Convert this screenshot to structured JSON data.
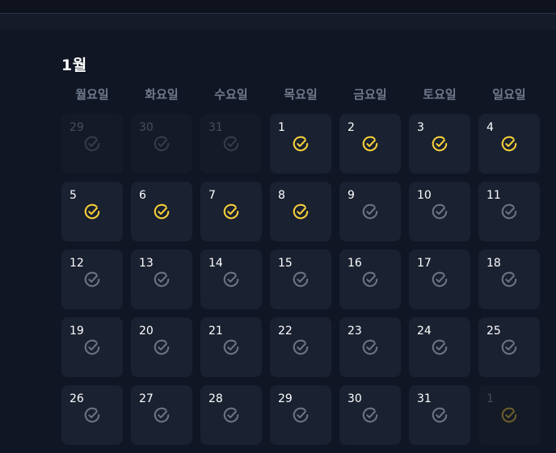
{
  "calendar": {
    "month_label": "1월",
    "weekdays": [
      "월요일",
      "화요일",
      "수요일",
      "목요일",
      "금요일",
      "토요일",
      "일요일"
    ],
    "colors": {
      "checked": "#f5cf3a",
      "unchecked": "#6b7484",
      "dim_unchecked": "#353c49",
      "dim_checked": "#6b5e2a"
    },
    "days": [
      {
        "label": "29",
        "in_month": false,
        "checked": false
      },
      {
        "label": "30",
        "in_month": false,
        "checked": false
      },
      {
        "label": "31",
        "in_month": false,
        "checked": false
      },
      {
        "label": "1",
        "in_month": true,
        "checked": true
      },
      {
        "label": "2",
        "in_month": true,
        "checked": true
      },
      {
        "label": "3",
        "in_month": true,
        "checked": true
      },
      {
        "label": "4",
        "in_month": true,
        "checked": true
      },
      {
        "label": "5",
        "in_month": true,
        "checked": true
      },
      {
        "label": "6",
        "in_month": true,
        "checked": true
      },
      {
        "label": "7",
        "in_month": true,
        "checked": true
      },
      {
        "label": "8",
        "in_month": true,
        "checked": true
      },
      {
        "label": "9",
        "in_month": true,
        "checked": false
      },
      {
        "label": "10",
        "in_month": true,
        "checked": false
      },
      {
        "label": "11",
        "in_month": true,
        "checked": false
      },
      {
        "label": "12",
        "in_month": true,
        "checked": false
      },
      {
        "label": "13",
        "in_month": true,
        "checked": false
      },
      {
        "label": "14",
        "in_month": true,
        "checked": false
      },
      {
        "label": "15",
        "in_month": true,
        "checked": false
      },
      {
        "label": "16",
        "in_month": true,
        "checked": false
      },
      {
        "label": "17",
        "in_month": true,
        "checked": false
      },
      {
        "label": "18",
        "in_month": true,
        "checked": false
      },
      {
        "label": "19",
        "in_month": true,
        "checked": false
      },
      {
        "label": "20",
        "in_month": true,
        "checked": false
      },
      {
        "label": "21",
        "in_month": true,
        "checked": false
      },
      {
        "label": "22",
        "in_month": true,
        "checked": false
      },
      {
        "label": "23",
        "in_month": true,
        "checked": false
      },
      {
        "label": "24",
        "in_month": true,
        "checked": false
      },
      {
        "label": "25",
        "in_month": true,
        "checked": false
      },
      {
        "label": "26",
        "in_month": true,
        "checked": false
      },
      {
        "label": "27",
        "in_month": true,
        "checked": false
      },
      {
        "label": "28",
        "in_month": true,
        "checked": false
      },
      {
        "label": "29",
        "in_month": true,
        "checked": false
      },
      {
        "label": "30",
        "in_month": true,
        "checked": false
      },
      {
        "label": "31",
        "in_month": true,
        "checked": false
      },
      {
        "label": "1",
        "in_month": false,
        "checked": true
      }
    ]
  }
}
